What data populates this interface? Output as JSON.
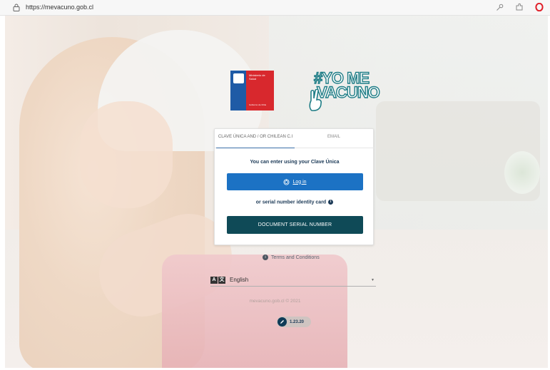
{
  "browser": {
    "url": "https://mevacuno.gob.cl",
    "icons": [
      "lock-icon",
      "key-icon",
      "extension-icon",
      "opera-icon"
    ]
  },
  "logos": {
    "gov_name": "Ministerio de Salud",
    "gov_sub": "Gobierno de Chile",
    "campaign_line1": "#YO ME",
    "campaign_line2": "VACUNO"
  },
  "login": {
    "tabs": [
      {
        "label": "CLAVE ÚNICA AND / OR CHILEAN C.I",
        "active": true
      },
      {
        "label": "EMAIL",
        "active": false
      }
    ],
    "heading": "You can enter using your Clave Única",
    "login_button": "Log in",
    "alt_text": "or serial number identity card",
    "document_button": "DOCUMENT SERIAL NUMBER"
  },
  "terms": "Terms and Conditions",
  "language": {
    "selected": "English"
  },
  "footer": "mevacuno.gob.cl © 2021",
  "version": "1.23.20",
  "colors": {
    "primary_blue": "#1c72c4",
    "dark_teal": "#0f4a57",
    "heading_navy": "#1c3a57",
    "gov_blue": "#1f5ba6",
    "gov_red": "#d8282d"
  }
}
